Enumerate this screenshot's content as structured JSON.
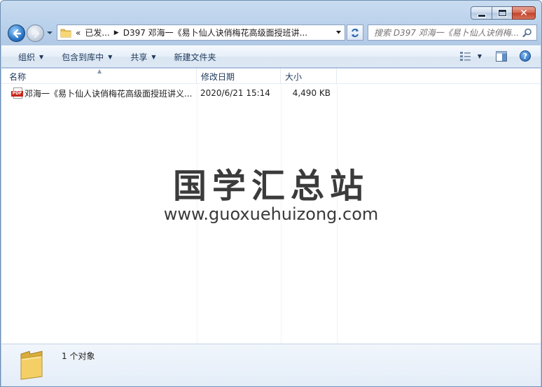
{
  "window": {
    "caption": {
      "minimize": "minimize",
      "maximize": "maximize",
      "close": "close"
    }
  },
  "address": {
    "overflow": "«",
    "segments": [
      "已发...",
      "D397 邓海一《易卜仙人诀俏梅花高级面授班讲..."
    ],
    "separator": "▶"
  },
  "search": {
    "placeholder": "搜索 D397 邓海一《易卜仙人诀俏梅..."
  },
  "toolbar": {
    "organize": "组织",
    "include_in_library": "包含到库中",
    "share": "共享",
    "new_folder": "新建文件夹",
    "help": "?"
  },
  "columns": {
    "name": "名称",
    "date_modified": "修改日期",
    "size": "大小"
  },
  "files": [
    {
      "icon": "pdf-file-icon",
      "name": "邓海一《易卜仙人诀俏梅花高级面授班讲义...",
      "date": "2020/6/21 15:14",
      "size": "4,490 KB"
    }
  ],
  "watermark": {
    "title": "国学汇总站",
    "url": "www.guoxuehuizong.com"
  },
  "details": {
    "count_text": "1 个对象"
  },
  "colors": {
    "frame": "#bcd3ec",
    "toolbar_text": "#1e395b",
    "pdf_red": "#c8251a",
    "close_red": "#c0402a"
  }
}
